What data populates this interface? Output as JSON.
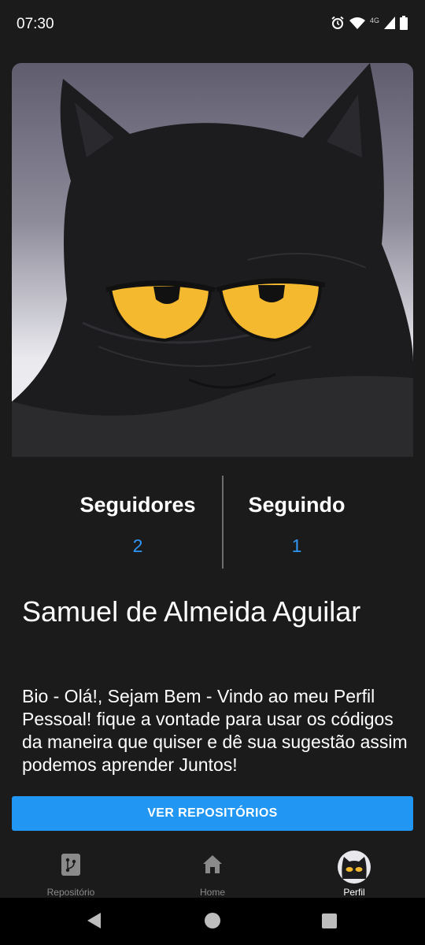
{
  "status_bar": {
    "time": "07:30",
    "network_label": "4G",
    "icons": [
      "alarm-icon",
      "wifi-icon",
      "signal-icon",
      "battery-icon"
    ]
  },
  "avatar": {
    "description_icon": "black-cat-avatar",
    "eye_color": "#f5b92f",
    "background_color": "#6e6c7b"
  },
  "stats": {
    "followers_label": "Seguidores",
    "followers_count": "2",
    "following_label": "Seguindo",
    "following_count": "1"
  },
  "profile": {
    "name": "Samuel de Almeida Aguilar",
    "bio": "Bio - Olá!, Sejam Bem - Vindo ao meu Perfil Pessoal! fique a vontade para usar os códigos da maneira que quiser e dê sua sugestão assim podemos aprender Juntos!"
  },
  "actions": {
    "view_repos_label": "VER REPOSITÓRIOS"
  },
  "bottom_nav": {
    "items": [
      {
        "label": "Repositório",
        "icon": "git-repo-icon",
        "active": false
      },
      {
        "label": "Home",
        "icon": "home-icon",
        "active": false
      },
      {
        "label": "Perfil",
        "icon": "profile-avatar-icon",
        "active": true
      }
    ]
  },
  "colors": {
    "background": "#1c1b1c",
    "accent": "#2196f3",
    "count_text": "#2f96f3",
    "inactive_nav": "#8a8a8a"
  }
}
